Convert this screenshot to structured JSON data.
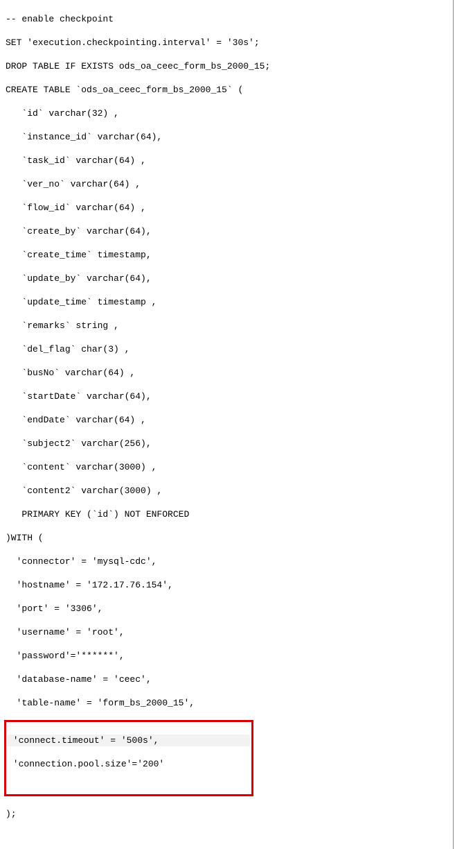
{
  "lines": {
    "l1": "-- enable checkpoint",
    "l2": "SET 'execution.checkpointing.interval' = '30s';",
    "l3": "DROP TABLE IF EXISTS ods_oa_ceec_form_bs_2000_15;",
    "l4": "CREATE TABLE `ods_oa_ceec_form_bs_2000_15` (",
    "l5": "   `id` varchar(32) ,",
    "l6": "   `instance_id` varchar(64),",
    "l7": "   `task_id` varchar(64) ,",
    "l8": "   `ver_no` varchar(64) ,",
    "l9": "   `flow_id` varchar(64) ,",
    "l10": "   `create_by` varchar(64),",
    "l11": "   `create_time` timestamp,",
    "l12": "   `update_by` varchar(64),",
    "l13": "   `update_time` timestamp ,",
    "l14": "   `remarks` string ,",
    "l15": "   `del_flag` char(3) ,",
    "l16": "   `busNo` varchar(64) ,",
    "l17": "   `startDate` varchar(64),",
    "l18": "   `endDate` varchar(64) ,",
    "l19": "   `subject2` varchar(256),",
    "l20": "   `content` varchar(3000) ,",
    "l21": "   `content2` varchar(3000) ,",
    "l22": "   PRIMARY KEY (`id`) NOT ENFORCED",
    "l23": ")WITH (",
    "l24": "  'connector' = 'mysql-cdc',",
    "l25": "  'hostname' = '172.17.76.154',",
    "l26": "  'port' = '3306',",
    "l27": "  'username' = 'root',",
    "l28": "  'password'='******',",
    "l29": "  'database-name' = 'ceec',",
    "l30": "  'table-name' = 'form_bs_2000_15',",
    "l31": " 'connect.timeout' = '500s',",
    "l32": " 'connection.pool.size'='200'",
    "l33": " ",
    "l34": ");"
  },
  "highlight": {
    "color": "#d40000",
    "rows": [
      "l31",
      "l32"
    ]
  }
}
